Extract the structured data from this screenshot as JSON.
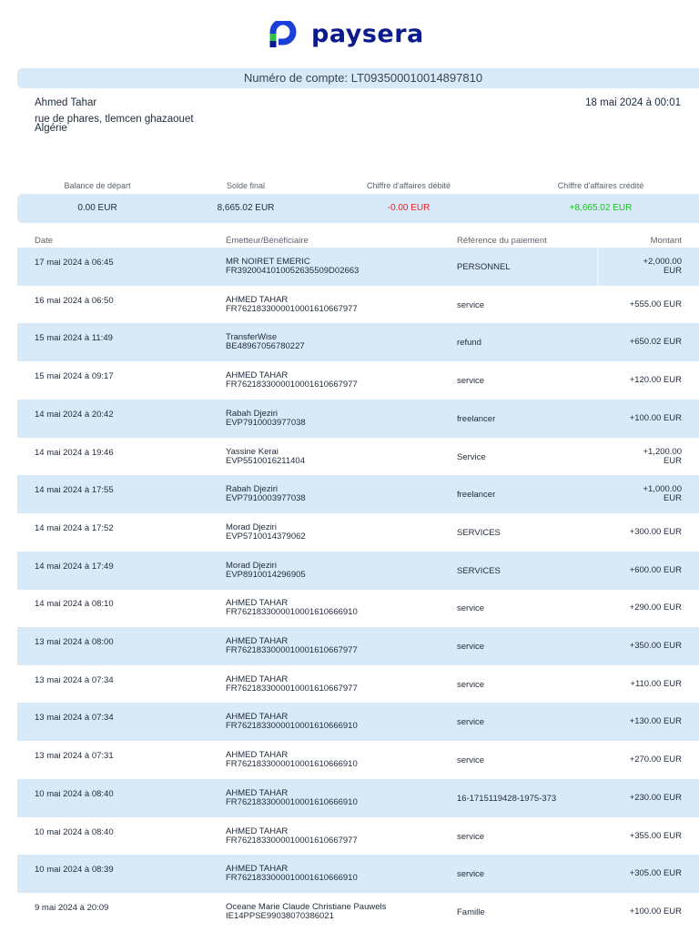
{
  "brand": {
    "name": "paysera"
  },
  "account": {
    "label": "Numéro de compte: LT093500010014897810"
  },
  "holder": {
    "name": "Ahmed Tahar",
    "address_line1": "rue de phares, tlemcen ghazaouet",
    "address_line2": "Algérie",
    "generated": "18 mai 2024 à 00:01"
  },
  "summary": {
    "headers": [
      "Balance de départ",
      "Solde final",
      "Chiffre d'affaires débité",
      "Chiffre d'affaires crédité"
    ],
    "values": [
      "0.00 EUR",
      "8,665.02 EUR",
      "-0.00 EUR",
      "+8,665.02 EUR"
    ],
    "colors": [
      "#1f2a3a",
      "#1f2a3a",
      "#e8222a",
      "#1fbf2a"
    ]
  },
  "table": {
    "headers": [
      "Date",
      "Émetteur/Bénéficiaire",
      "Référence du paiement",
      "Montant"
    ],
    "rows": [
      {
        "date": "17 mai 2024 à 06:45",
        "name": "MR NOIRET EMERIC",
        "account": "FR3920041010052635509D02663",
        "ref": "PERSONNEL",
        "amount": "+2,000.00",
        "currency": "EUR"
      },
      {
        "date": "16 mai 2024 à 06:50",
        "name": "AHMED TAHAR",
        "account": "FR7621833000010001610667977",
        "ref": "service",
        "amount": "+555.00",
        "currency": "EUR"
      },
      {
        "date": "15 mai 2024 à 11:49",
        "name": "TransferWise",
        "account": "BE48967056780227",
        "ref": "refund",
        "amount": "+650.02",
        "currency": "EUR"
      },
      {
        "date": "15 mai 2024 à 09:17",
        "name": "AHMED TAHAR",
        "account": "FR7621833000010001610667977",
        "ref": "service",
        "amount": "+120.00",
        "currency": "EUR"
      },
      {
        "date": "14 mai 2024 à 20:42",
        "name": "Rabah Djeziri",
        "account": "EVP7910003977038",
        "ref": "freelancer",
        "amount": "+100.00",
        "currency": "EUR"
      },
      {
        "date": "14 mai 2024 à 19:46",
        "name": "Yassine Kerai",
        "account": "EVP5510016211404",
        "ref": "Service",
        "amount": "+1,200.00",
        "currency": "EUR"
      },
      {
        "date": "14 mai 2024 à 17:55",
        "name": "Rabah Djeziri",
        "account": "EVP7910003977038",
        "ref": "freelancer",
        "amount": "+1,000.00",
        "currency": "EUR"
      },
      {
        "date": "14 mai 2024 à 17:52",
        "name": "Morad Djeziri",
        "account": "EVP5710014379062",
        "ref": "SERVICES",
        "amount": "+300.00",
        "currency": "EUR"
      },
      {
        "date": "14 mai 2024 à 17:49",
        "name": "Morad Djeziri",
        "account": "EVP8910014296905",
        "ref": "SERVICES",
        "amount": "+600.00",
        "currency": "EUR"
      },
      {
        "date": "14 mai 2024 à 08:10",
        "name": "AHMED TAHAR",
        "account": "FR7621833000010001610666910",
        "ref": "service",
        "amount": "+290.00",
        "currency": "EUR"
      },
      {
        "date": "13 mai 2024 à 08:00",
        "name": "AHMED TAHAR",
        "account": "FR7621833000010001610667977",
        "ref": "service",
        "amount": "+350.00",
        "currency": "EUR"
      },
      {
        "date": "13 mai 2024 à 07:34",
        "name": "AHMED TAHAR",
        "account": "FR7621833000010001610667977",
        "ref": "service",
        "amount": "+110.00",
        "currency": "EUR"
      },
      {
        "date": "13 mai 2024 à 07:34",
        "name": "AHMED TAHAR",
        "account": "FR7621833000010001610666910",
        "ref": "service",
        "amount": "+130.00",
        "currency": "EUR"
      },
      {
        "date": "13 mai 2024 à 07:31",
        "name": "AHMED TAHAR",
        "account": "FR7621833000010001610666910",
        "ref": "service",
        "amount": "+270.00",
        "currency": "EUR"
      },
      {
        "date": "10 mai 2024 à 08:40",
        "name": "AHMED TAHAR",
        "account": "FR7621833000010001610666910",
        "ref": "16-1715119428-1975-373",
        "amount": "+230.00",
        "currency": "EUR"
      },
      {
        "date": "10 mai 2024 à 08:40",
        "name": "AHMED TAHAR",
        "account": "FR7621833000010001610667977",
        "ref": "service",
        "amount": "+355.00",
        "currency": "EUR"
      },
      {
        "date": "10 mai 2024 à 08:39",
        "name": "AHMED TAHAR",
        "account": "FR7621833000010001610666910",
        "ref": "service",
        "amount": "+305.00",
        "currency": "EUR"
      },
      {
        "date": "9 mai 2024 à 20:09",
        "name": "Oceane Marie Claude Christiane Pauwels",
        "account": "IE14PPSE99038070386021",
        "ref": "Famille",
        "amount": "+100.00",
        "currency": "EUR"
      }
    ]
  }
}
